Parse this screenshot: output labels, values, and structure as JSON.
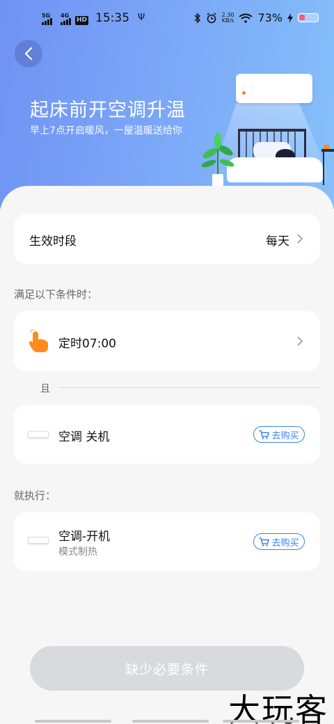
{
  "status_bar": {
    "net1": "5G",
    "net2": "4G",
    "hd": "HD",
    "time": "15:35",
    "speed_value": "2.30",
    "speed_unit": "KB/s",
    "battery": "73%"
  },
  "header": {
    "title": "起床前开空调升温",
    "subtitle": "早上7点开启暖风，一屋温暖送给你"
  },
  "period": {
    "label": "生效时段",
    "value": "每天"
  },
  "conditions": {
    "section_label": "满足以下条件时：",
    "timer_label": "定时07:00",
    "and_label": "且",
    "device_condition_label": "空调 关机",
    "buy_label": "去购买"
  },
  "actions": {
    "section_label": "就执行：",
    "device_action_label": "空调-开机",
    "device_action_desc": "模式制热",
    "buy_label": "去购买"
  },
  "footer": {
    "button_label": "缺少必要条件"
  },
  "watermark": "大玩客",
  "colors": {
    "accent_blue": "#3b82f0",
    "hand_orange": "#ff8a1e",
    "disabled_button": "#d9dadd"
  }
}
